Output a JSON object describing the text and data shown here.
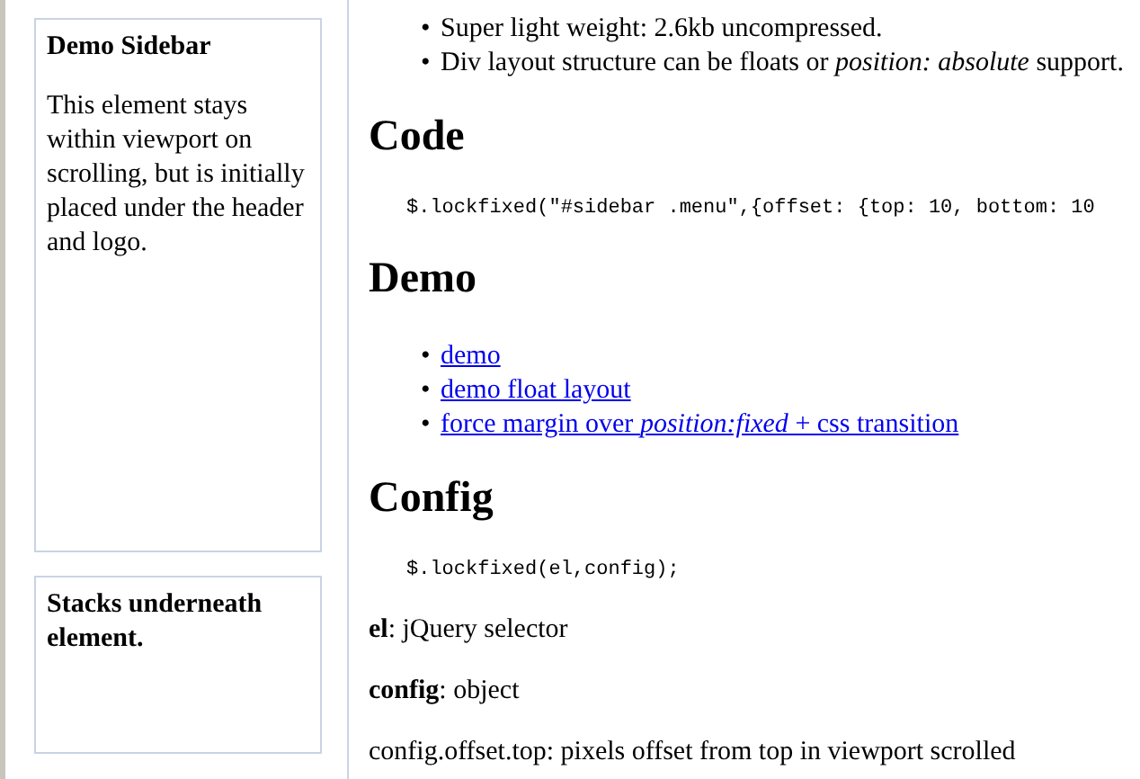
{
  "sidebar": {
    "boxes": [
      {
        "title": "Demo Sidebar",
        "text": "This element stays within viewport on scrolling, but is initially placed under the header and logo."
      },
      {
        "title": "Stacks underneath element."
      }
    ]
  },
  "features": [
    {
      "marker": "•",
      "text": "Super light weight: 2.6kb uncompressed."
    },
    {
      "marker": "•",
      "text": "Div layout structure can be floats or *position: absolute* support."
    }
  ],
  "sections": [
    {
      "heading": "Code",
      "code": "$.lockfixed(\"#sidebar .menu\",{offset: {top: 10, bottom: 10"
    },
    {
      "heading": "Demo",
      "links": [
        {
          "marker": "•",
          "text": "demo"
        },
        {
          "marker": "•",
          "text": "demo float layout"
        },
        {
          "marker": "•",
          "text": "force margin over *position:fixed* + css transition"
        }
      ]
    },
    {
      "heading": "Config",
      "code": "$.lockfixed(el,config);",
      "paragraphs": [
        "**el**: jQuery selector",
        "**config**: object",
        "config.offset.top: pixels offset from top in viewport scrolled"
      ]
    }
  ]
}
